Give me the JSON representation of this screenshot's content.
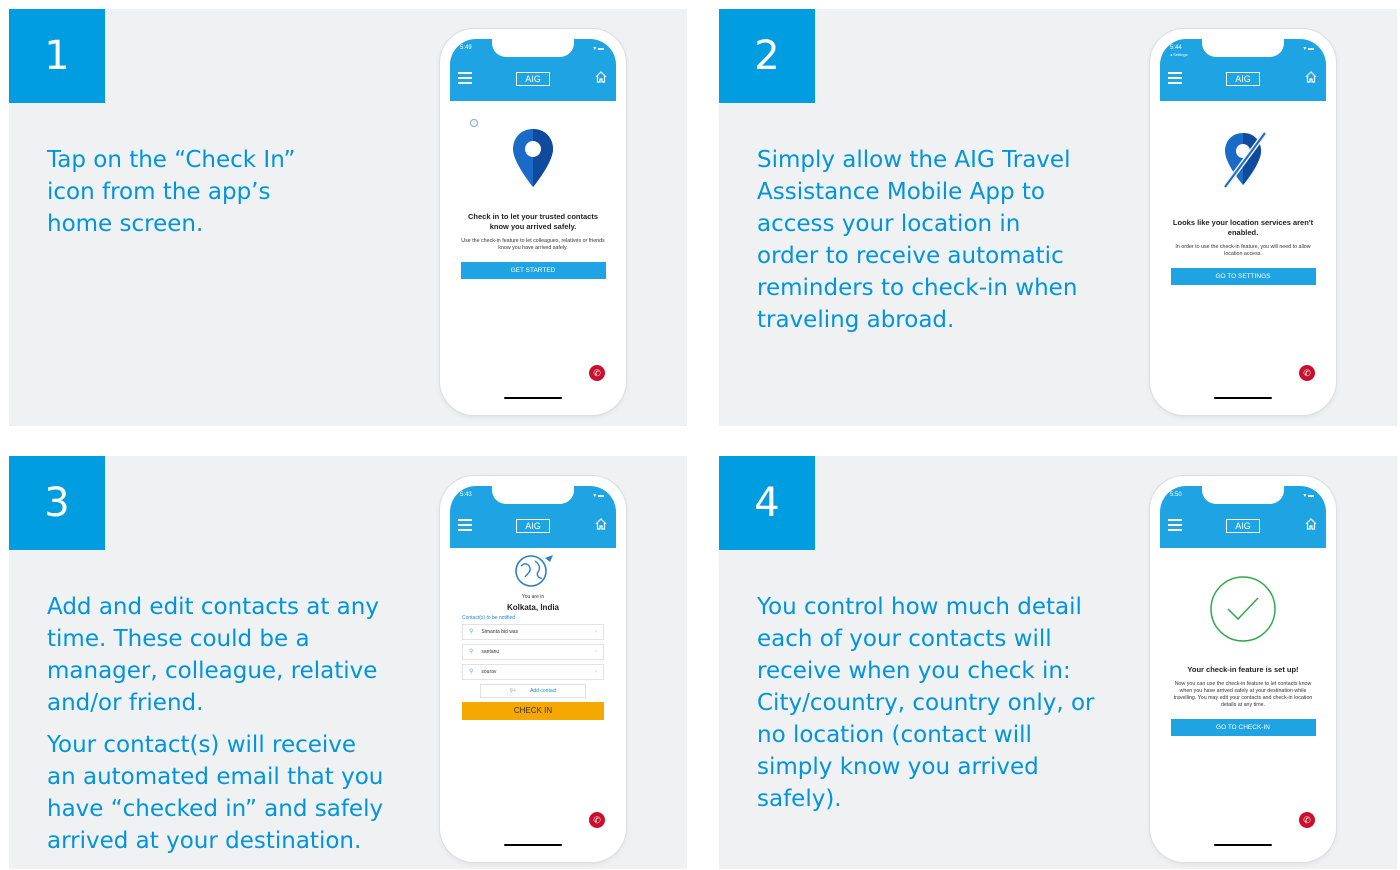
{
  "colors": {
    "accent": "#009de0",
    "app_bar": "#1ea4e3",
    "call": "#c8102e",
    "checkin": "#f5a800",
    "success": "#2eaa4a"
  },
  "steps": [
    {
      "number": "1",
      "text": [
        "Tap on the “Check In” icon from the app’s home screen."
      ],
      "phone": {
        "time": "5:49",
        "logo": "AIG",
        "info": "i",
        "heading": "Check in to let your trusted contacts know you arrived safely.",
        "body": "Use the check-in feature to let colleagues, relatives or friends know you have arrived safely.",
        "button": "GET STARTED",
        "icons": [
          "menu-icon",
          "home-icon",
          "location-pin-icon",
          "phone-icon"
        ]
      }
    },
    {
      "number": "2",
      "text": [
        "Simply allow the AIG Travel Assistance Mobile App to access your location in order to receive automatic reminders to check-in when traveling abroad."
      ],
      "phone": {
        "time": "5:44",
        "sub": "◂ Settings",
        "logo": "AIG",
        "heading": "Looks like your location services aren't enabled.",
        "body": "In order to use the check-in feature, you will need to allow location access.",
        "button": "GO TO SETTINGS",
        "icons": [
          "menu-icon",
          "home-icon",
          "location-off-icon",
          "phone-icon"
        ]
      }
    },
    {
      "number": "3",
      "text": [
        "Add and edit contacts at any time. These could be a manager, colleague, relative and/or friend.",
        "Your contact(s) will receive an automated email that you have “checked in” and safely arrived at your destination."
      ],
      "phone": {
        "time": "5:43",
        "logo": "AIG",
        "you_are_in": "You are in",
        "city": "Kolkata, India",
        "contacts_label": "Contact(s) to be notified",
        "contacts": [
          "Simanta bid was",
          "santanu",
          "sourav"
        ],
        "add_contact": "Add contact",
        "button": "CHECK IN",
        "icons": [
          "menu-icon",
          "home-icon",
          "globe-icon",
          "user-icon",
          "add-user-icon",
          "phone-icon"
        ]
      }
    },
    {
      "number": "4",
      "text": [
        "You control how much detail each of your contacts will receive when you check in: City/country, country only, or no location (contact will simply know you arrived safely)."
      ],
      "phone": {
        "time": "5:50",
        "logo": "AIG",
        "heading": "Your check-in feature is set up!",
        "body": "Now you can use the check-in feature to let contacts know when you have arrived safely at your destination while travelling. You may edit your contacts and check-in location details at any time.",
        "button": "GO TO CHECK-IN",
        "icons": [
          "menu-icon",
          "home-icon",
          "checkmark-circle-icon",
          "phone-icon"
        ]
      }
    }
  ]
}
